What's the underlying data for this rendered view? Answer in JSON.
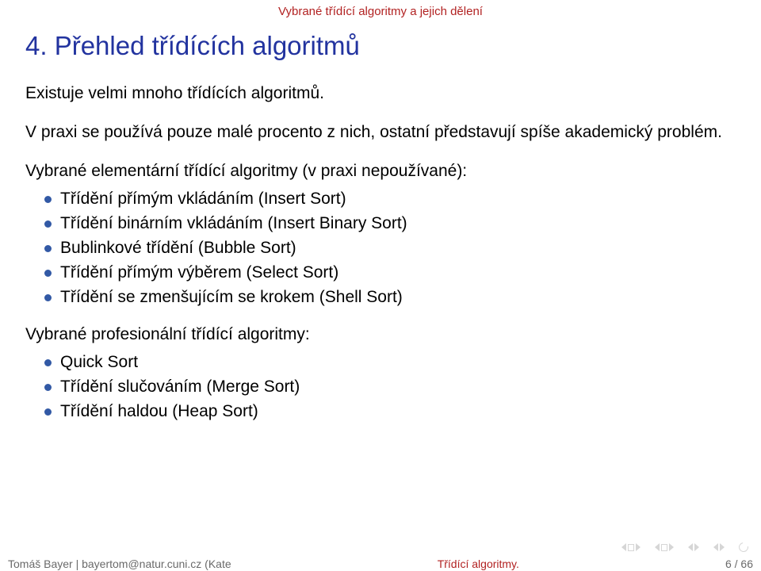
{
  "section": "Vybrané třídící algoritmy a jejich dělení",
  "title": "4. Přehled třídících algoritmů",
  "para1": "Existuje velmi mnoho třídících algoritmů.",
  "para2": "V praxi se používá pouze malé procento z nich, ostatní představují spíše akademický problém.",
  "list1_head": "Vybrané elementární třídící algoritmy (v praxi nepoužívané):",
  "list1": [
    "Třídění přímým vkládáním (Insert Sort)",
    "Třídění binárním vkládáním (Insert Binary Sort)",
    "Bublinkové třídění (Bubble Sort)",
    "Třídění přímým výběrem (Select Sort)",
    "Třídění se zmenšujícím se krokem (Shell Sort)"
  ],
  "list2_head": "Vybrané profesionální třídící algoritmy:",
  "list2": [
    "Quick Sort",
    "Třídění slučováním (Merge Sort)",
    "Třídění haldou (Heap Sort)"
  ],
  "footer": {
    "left": "Tomáš Bayer | bayertom@natur.cuni.cz (Kate",
    "center": "Třídící algoritmy.",
    "right": "6 / 66"
  }
}
